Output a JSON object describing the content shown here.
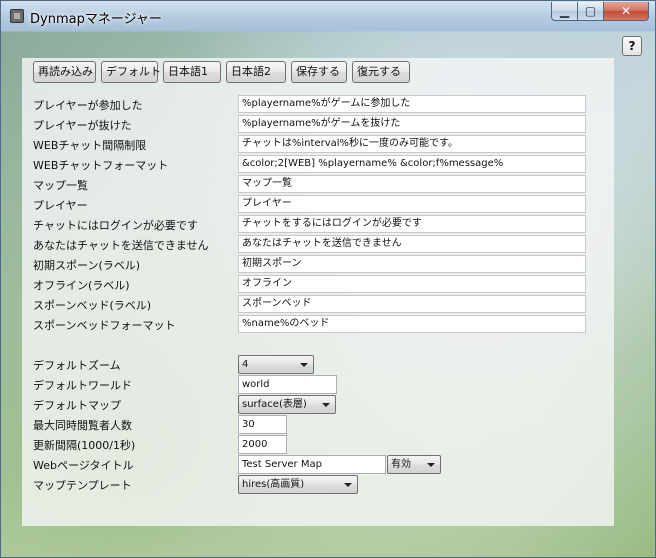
{
  "window": {
    "title": "Dynmapマネージャー",
    "minimize_label": "▁",
    "maximize_label": "▢",
    "close_label": "✕",
    "help_label": "?"
  },
  "toolbar": {
    "buttons": [
      "再読み込み",
      "デフォルト",
      "日本語1",
      "日本語2",
      "保存する",
      "復元する"
    ]
  },
  "messages": [
    {
      "label": "プレイヤーが参加した",
      "value": "%playername%がゲームに参加した"
    },
    {
      "label": "プレイヤーが抜けた",
      "value": "%playername%がゲームを抜けた"
    },
    {
      "label": "WEBチャット間隔制限",
      "value": "チャットは%interval%秒に一度のみ可能です。"
    },
    {
      "label": "WEBチャットフォーマット",
      "value": "&color;2[WEB] %playername% &color;f%message%"
    },
    {
      "label": "マップ一覧",
      "value": "マップ一覧"
    },
    {
      "label": "プレイヤー",
      "value": "プレイヤー"
    },
    {
      "label": "チャットにはログインが必要です",
      "value": "チャットをするにはログインが必要です"
    },
    {
      "label": "あなたはチャットを送信できません",
      "value": "あなたはチャットを送信できません"
    },
    {
      "label": "初期スポーン(ラベル)",
      "value": "初期スポーン"
    },
    {
      "label": "オフライン(ラベル)",
      "value": "オフライン"
    },
    {
      "label": "スポーンベッド(ラベル)",
      "value": "スポーンベッド"
    },
    {
      "label": "スポーンベッドフォーマット",
      "value": "%name%のベッド"
    }
  ],
  "settings": {
    "default_zoom": {
      "label": "デフォルトズーム",
      "value": "4"
    },
    "default_world": {
      "label": "デフォルトワールド",
      "value": "world"
    },
    "default_map": {
      "label": "デフォルトマップ",
      "value": "surface(表層)"
    },
    "max_viewers": {
      "label": "最大同時閲覧者人数",
      "value": "30"
    },
    "update_interval": {
      "label": "更新間隔(1000/1秒)",
      "value": "2000"
    },
    "page_title": {
      "label": "Webページタイトル",
      "value": "Test Server Map",
      "toggle": "有効"
    },
    "map_template": {
      "label": "マップテンプレート",
      "value": "hires(高画質)"
    }
  }
}
